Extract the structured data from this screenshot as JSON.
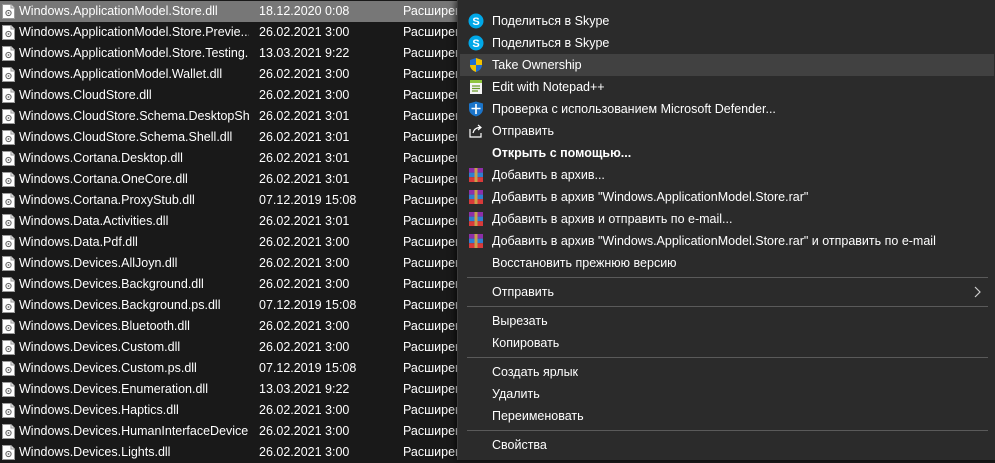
{
  "files": [
    {
      "name": "Windows.ApplicationModel.Store.dll",
      "date": "18.12.2020 0:08",
      "type": "Расширение прил",
      "selected": true
    },
    {
      "name": "Windows.ApplicationModel.Store.Previe...",
      "date": "26.02.2021 3:00",
      "type": "Расширение прил"
    },
    {
      "name": "Windows.ApplicationModel.Store.Testing...",
      "date": "13.03.2021 9:22",
      "type": "Расширение прил"
    },
    {
      "name": "Windows.ApplicationModel.Wallet.dll",
      "date": "26.02.2021 3:00",
      "type": "Расширение прил"
    },
    {
      "name": "Windows.CloudStore.dll",
      "date": "26.02.2021 3:00",
      "type": "Расширение прил"
    },
    {
      "name": "Windows.CloudStore.Schema.DesktopSh...",
      "date": "26.02.2021 3:01",
      "type": "Расширение прил"
    },
    {
      "name": "Windows.CloudStore.Schema.Shell.dll",
      "date": "26.02.2021 3:01",
      "type": "Расширение прил"
    },
    {
      "name": "Windows.Cortana.Desktop.dll",
      "date": "26.02.2021 3:01",
      "type": "Расширение прил"
    },
    {
      "name": "Windows.Cortana.OneCore.dll",
      "date": "26.02.2021 3:01",
      "type": "Расширение прил"
    },
    {
      "name": "Windows.Cortana.ProxyStub.dll",
      "date": "07.12.2019 15:08",
      "type": "Расширение прил"
    },
    {
      "name": "Windows.Data.Activities.dll",
      "date": "26.02.2021 3:01",
      "type": "Расширение прил"
    },
    {
      "name": "Windows.Data.Pdf.dll",
      "date": "26.02.2021 3:00",
      "type": "Расширение прил"
    },
    {
      "name": "Windows.Devices.AllJoyn.dll",
      "date": "26.02.2021 3:00",
      "type": "Расширение прил"
    },
    {
      "name": "Windows.Devices.Background.dll",
      "date": "26.02.2021 3:00",
      "type": "Расширение прил"
    },
    {
      "name": "Windows.Devices.Background.ps.dll",
      "date": "07.12.2019 15:08",
      "type": "Расширение прил"
    },
    {
      "name": "Windows.Devices.Bluetooth.dll",
      "date": "26.02.2021 3:00",
      "type": "Расширение прил"
    },
    {
      "name": "Windows.Devices.Custom.dll",
      "date": "26.02.2021 3:00",
      "type": "Расширение прил"
    },
    {
      "name": "Windows.Devices.Custom.ps.dll",
      "date": "07.12.2019 15:08",
      "type": "Расширение прил"
    },
    {
      "name": "Windows.Devices.Enumeration.dll",
      "date": "13.03.2021 9:22",
      "type": "Расширение прил"
    },
    {
      "name": "Windows.Devices.Haptics.dll",
      "date": "26.02.2021 3:00",
      "type": "Расширение прил"
    },
    {
      "name": "Windows.Devices.HumanInterfaceDevice...",
      "date": "26.02.2021 3:00",
      "type": "Расширение прил"
    },
    {
      "name": "Windows.Devices.Lights.dll",
      "date": "26.02.2021 3:00",
      "type": "Расширение прил"
    }
  ],
  "menu": {
    "share_skype_1": "Поделиться в Skype",
    "share_skype_2": "Поделиться в Skype",
    "take_ownership": "Take Ownership",
    "edit_notepad": "Edit with Notepad++",
    "defender": "Проверка с использованием Microsoft Defender...",
    "send_share": "Отправить",
    "open_with": "Открыть с помощью...",
    "add_archive": "Добавить в архив...",
    "add_archive_named": "Добавить в архив \"Windows.ApplicationModel.Store.rar\"",
    "add_archive_email": "Добавить в архив и отправить по e-mail...",
    "add_archive_named_email": "Добавить в архив \"Windows.ApplicationModel.Store.rar\" и отправить по e-mail",
    "restore": "Восстановить прежнюю версию",
    "send_to": "Отправить",
    "cut": "Вырезать",
    "copy": "Копировать",
    "shortcut": "Создать ярлык",
    "delete": "Удалить",
    "rename": "Переименовать",
    "properties": "Свойства"
  },
  "icons": {
    "skype": "skype-icon",
    "shield": "uac-shield-icon",
    "notepad": "notepad-plus-plus-icon",
    "defender": "defender-icon",
    "share": "share-icon",
    "winrar": "winrar-icon",
    "file": "dll-file-icon"
  },
  "colors": {
    "background": "#191919",
    "menu_background": "#2b2b2b",
    "menu_hover": "#414141",
    "selected_row": "#777777",
    "skype_blue": "#00a8e8"
  }
}
